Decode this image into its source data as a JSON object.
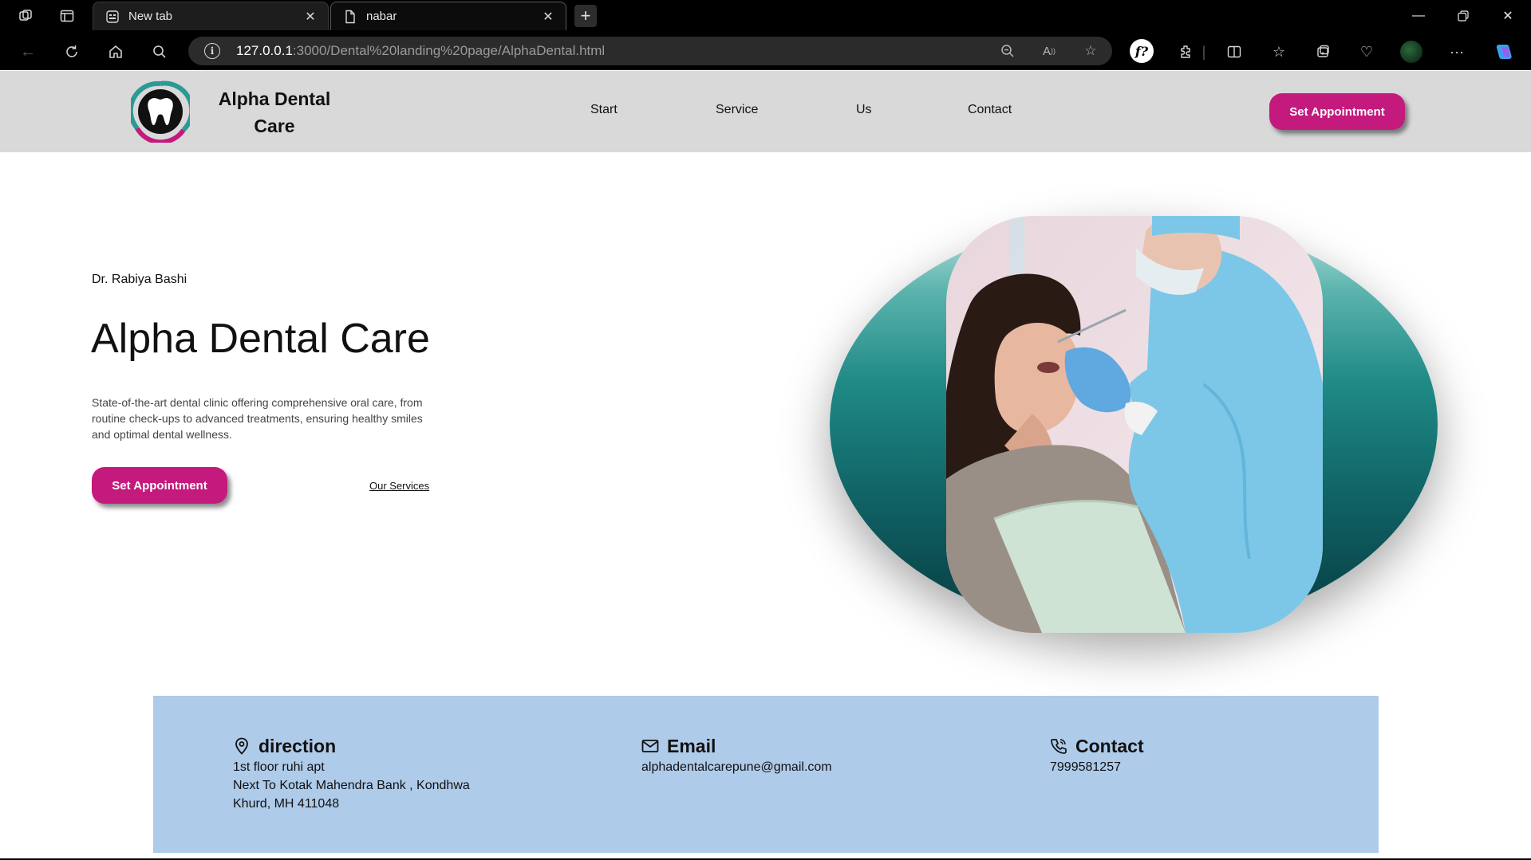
{
  "browser": {
    "tabs": [
      {
        "title": "New tab",
        "icon": "new-tab-page-icon"
      },
      {
        "title": "nabar",
        "icon": "document-icon"
      }
    ],
    "url": {
      "host": "127.0.0.1",
      "path": ":3000/Dental%20landing%20page/AlphaDental.html"
    }
  },
  "header": {
    "brand": "Alpha Dental Care",
    "nav": [
      "Start",
      "Service",
      "Us",
      "Contact"
    ],
    "cta": "Set Appointment"
  },
  "hero": {
    "doctor": "Dr. Rabiya Bashi",
    "title": "Alpha Dental Care",
    "description": "State-of-the-art dental clinic offering comprehensive oral care, from routine check-ups to advanced treatments, ensuring healthy smiles and optimal dental wellness.",
    "cta": "Set Appointment",
    "link": "Our Services"
  },
  "info": {
    "direction": {
      "heading": "direction",
      "lines": [
        "1st floor ruhi apt",
        "Next To Kotak Mahendra Bank , Kondhwa",
        "Khurd, MH 411048"
      ]
    },
    "email": {
      "heading": "Email",
      "value": "alphadentalcarepune@gmail.com"
    },
    "contact": {
      "heading": "Contact",
      "value": "7999581257"
    }
  },
  "colors": {
    "accent": "#c41a7d",
    "header_bg": "#d9d9d9",
    "info_bg": "#aecbea",
    "teal": "#1f8a86"
  }
}
